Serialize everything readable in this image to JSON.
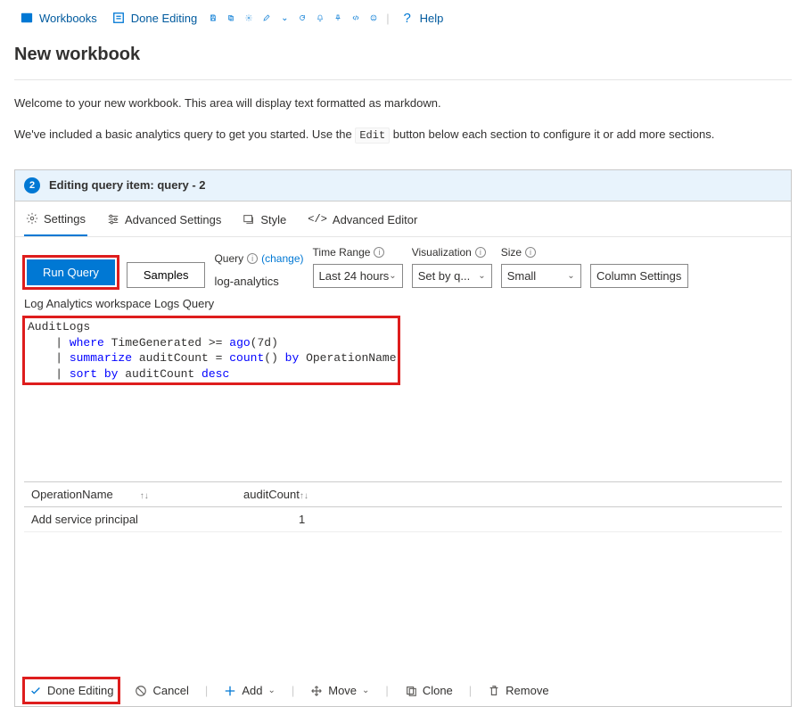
{
  "toolbar": {
    "workbooks": "Workbooks",
    "done_editing": "Done Editing",
    "help": "Help"
  },
  "page_title": "New workbook",
  "intro_line1": "Welcome to your new workbook. This area will display text formatted as markdown.",
  "intro_line2a": "We've included a basic analytics query to get you started. Use the ",
  "intro_code": "Edit",
  "intro_line2b": " button below each section to configure it or add more sections.",
  "editor": {
    "step": "2",
    "title": "Editing query item: query - 2",
    "tabs": {
      "settings": "Settings",
      "advanced_settings": "Advanced Settings",
      "style": "Style",
      "advanced_editor": "Advanced Editor"
    },
    "controls": {
      "run_query": "Run Query",
      "samples": "Samples",
      "query_label": "Query",
      "change": "(change)",
      "query_value": "log-analytics",
      "time_range_label": "Time Range",
      "time_range_value": "Last 24 hours",
      "visualization_label": "Visualization",
      "visualization_value": "Set by q...",
      "size_label": "Size",
      "size_value": "Small",
      "column_settings": "Column Settings"
    },
    "subtitle": "Log Analytics workspace Logs Query",
    "code": {
      "l1": "AuditLogs",
      "l2_prefix": "    | ",
      "l2_kw1": "where",
      "l2_mid": " TimeGenerated >= ",
      "l2_fn": "ago",
      "l2_suffix": "(7d)",
      "l3_prefix": "    | ",
      "l3_kw1": "summarize",
      "l3_mid1": " auditCount = ",
      "l3_fn": "count",
      "l3_mid2": "() ",
      "l3_kw2": "by",
      "l3_suffix": " OperationName",
      "l4_prefix": "    | ",
      "l4_kw1": "sort by",
      "l4_mid": " auditCount ",
      "l4_kw2": "desc"
    },
    "results": {
      "col1": "OperationName",
      "col2": "auditCount",
      "row1_op": "Add service principal",
      "row1_count": "1"
    },
    "bottom": {
      "done_editing": "Done Editing",
      "cancel": "Cancel",
      "add": "Add",
      "move": "Move",
      "clone": "Clone",
      "remove": "Remove"
    }
  }
}
